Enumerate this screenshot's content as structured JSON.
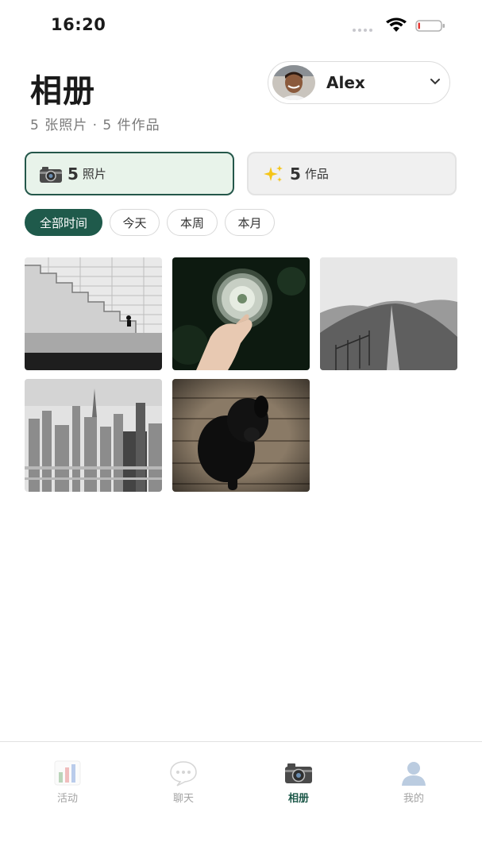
{
  "status_bar": {
    "time": "16:20"
  },
  "header": {
    "title": "相册",
    "subtitle": "5 张照片 · 5 件作品",
    "user": {
      "name": "Alex",
      "avatar_icon": "avatar-photo"
    }
  },
  "segments": {
    "photos": {
      "icon": "camera-icon",
      "count": "5",
      "label": "照片"
    },
    "works": {
      "icon": "sparkles-icon",
      "count": "5",
      "label": "作品"
    }
  },
  "filters": [
    "全部时间",
    "今天",
    "本周",
    "本月"
  ],
  "active_filter": "全部时间",
  "photos": [
    {
      "subject": "stairs",
      "icon": "photo-stairs"
    },
    {
      "subject": "dandelion",
      "icon": "photo-dandelion"
    },
    {
      "subject": "hills",
      "icon": "photo-hills"
    },
    {
      "subject": "city",
      "icon": "photo-city"
    },
    {
      "subject": "dog",
      "icon": "photo-dog"
    }
  ],
  "bottom_nav": [
    {
      "label": "活动",
      "icon": "chart-icon",
      "active": false
    },
    {
      "label": "聊天",
      "icon": "chat-bubble-icon",
      "active": false
    },
    {
      "label": "相册",
      "icon": "camera-icon",
      "active": true
    },
    {
      "label": "我的",
      "icon": "person-icon",
      "active": false
    }
  ],
  "colors": {
    "accent": "#1f5a4b",
    "segment_active_bg": "#e8f3ea",
    "segment_inactive_bg": "#f0f0f0"
  }
}
